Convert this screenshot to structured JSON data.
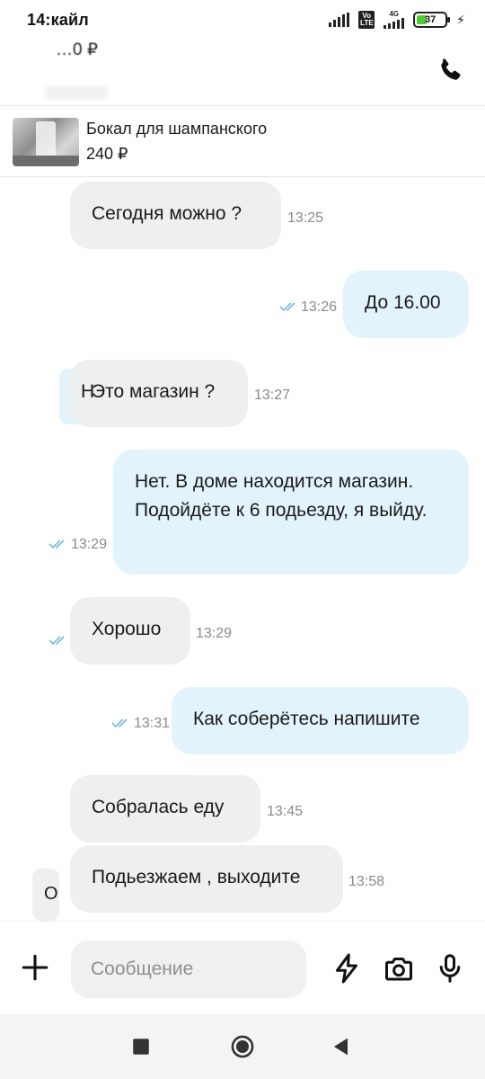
{
  "status": {
    "time": "14:",
    "carrier": "кайл",
    "battery": "37",
    "network": "4G",
    "volte": "Vo LTE"
  },
  "header": {
    "title": "…0 ₽"
  },
  "product": {
    "title": "Бокал для шампанского",
    "price": "240 ₽"
  },
  "messages": [
    {
      "dir": "in",
      "text": "Сегодня можно ?",
      "time": "13:25"
    },
    {
      "dir": "out",
      "text": "До 16.00",
      "time": "13:26"
    },
    {
      "dir": "in",
      "text": "Это магазин ?",
      "time": "13:27",
      "peek": "Н"
    },
    {
      "dir": "out",
      "text": "Нет. В доме находится магазин. Подойдёте к 6 подьезду, я выйду.",
      "time": "13:29"
    },
    {
      "dir": "in",
      "text": "Хорошо",
      "time": "13:29"
    },
    {
      "dir": "out",
      "text": "Как соберётесь напишите",
      "time": "13:31"
    },
    {
      "dir": "in",
      "text": "Собралась еду",
      "time": "13:45"
    },
    {
      "dir": "in",
      "text": "Подьезжаем , выходите",
      "time": "13:58",
      "peek": "О"
    }
  ],
  "composer": {
    "placeholder": "Сообщение"
  },
  "icons": {
    "call": "phone-icon",
    "add": "plus-icon",
    "quick": "lightning-icon",
    "camera": "camera-icon",
    "mic": "microphone-icon"
  },
  "colors": {
    "incoming": "#efefef",
    "outgoing": "#e3f3fc",
    "read_tick": "#7ab9dc",
    "battery": "#57c734"
  }
}
